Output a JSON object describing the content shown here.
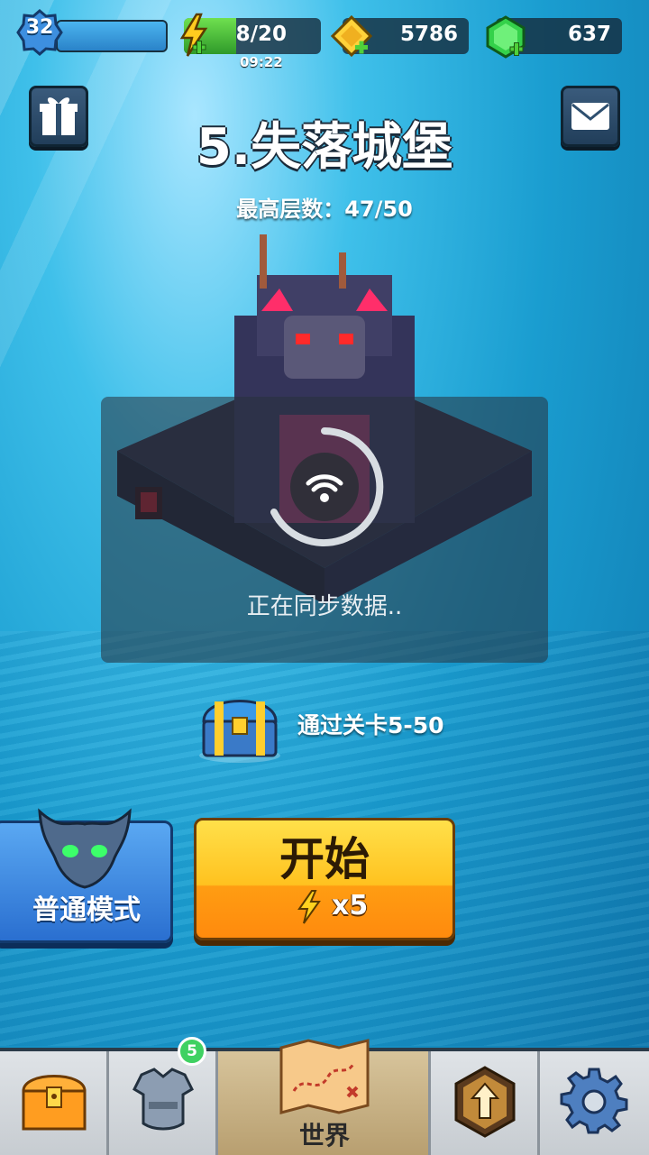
{
  "player": {
    "level": "32"
  },
  "resources": {
    "energy": "8/20",
    "energy_timer": "09:22",
    "coins": "5786",
    "gems": "637"
  },
  "stage": {
    "title": "5.失落城堡",
    "best_floor_label": "最高层数：47/50"
  },
  "sync": {
    "message": "正在同步数据.."
  },
  "reward": {
    "text": "通过关卡5-50"
  },
  "mode": {
    "label": "普通模式"
  },
  "start": {
    "label": "开始",
    "cost": "x5"
  },
  "nav": {
    "badge_count": "5",
    "world_label": "世界"
  },
  "colors": {
    "accent_yellow": "#ffc21f",
    "mode_blue": "#2a6fd0",
    "gem_green": "#3fd162"
  }
}
